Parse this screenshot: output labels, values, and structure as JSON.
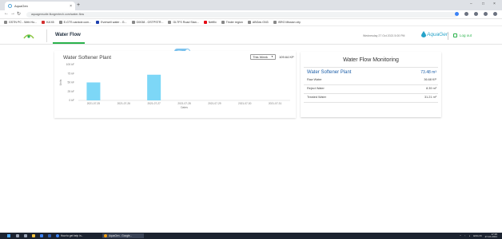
{
  "browser": {
    "tab_title": "AquaGen",
    "tab_close": "×",
    "new_tab": "+",
    "url": "aquagensuite.fluxgentech.com/water-flow",
    "window_controls": [
      "−",
      "□",
      "×"
    ],
    "bookmarks": [
      "GSTN PC - Web Ho...",
      "KA'45",
      "E-GTS cardcdr.com...",
      "Everwell water - G...",
      "G0038 - GSTPSTR...",
      "GLTFS Road Stan...",
      "Netflix",
      "Tinder region",
      "ABGds GN3",
      "ISRO Mission city"
    ]
  },
  "header": {
    "nav_item": "Water Flow",
    "datetime": "Wednesday 27 Oct 2021 5:00 PM",
    "brand": "AquaGen",
    "logout": "Log out",
    "accent_color": "#2bb24c"
  },
  "toggle": {
    "label": "ON",
    "state": "on"
  },
  "chart_card": {
    "title": "Water Softener Plant",
    "period": "This Week",
    "total": "109.64 KP"
  },
  "chart_data": {
    "type": "bar",
    "title": "Water Softener Plant",
    "xlabel": "Dates",
    "ylabel": "Units",
    "categories": [
      "2021-07-25",
      "2021-07-26",
      "2021-07-27",
      "2021-07-28",
      "2021-07-29",
      "2021-07-30",
      "2021-07-31"
    ],
    "values": [
      50.1,
      0,
      71.6,
      0,
      0,
      0,
      0
    ],
    "ylim": [
      0,
      100
    ],
    "yticks": [
      0,
      25,
      50,
      75,
      100
    ],
    "yticklabels": [
      "0 kF",
      "25 kF",
      "50 kF",
      "75 kF",
      "100 kF"
    ],
    "bar_color": "#7dd7f7",
    "grid": false,
    "legend": "none"
  },
  "monitoring": {
    "title": "Water Flow Monitoring",
    "headline": {
      "label": "Water Softener Plant",
      "value": "73.48 m³"
    },
    "rows": [
      {
        "label": "Raw Water",
        "value": "36.68 KP"
      },
      {
        "label": "Reject Water",
        "value": "8.39 m³"
      },
      {
        "label": "Treated Water",
        "value": "31.21 m³"
      }
    ]
  },
  "taskbar": {
    "tasks": [
      "How to get help in...",
      "AquaGen - Google..."
    ],
    "lang": "ENG\nIN",
    "time": "17:35",
    "date": "27-10-2021"
  }
}
